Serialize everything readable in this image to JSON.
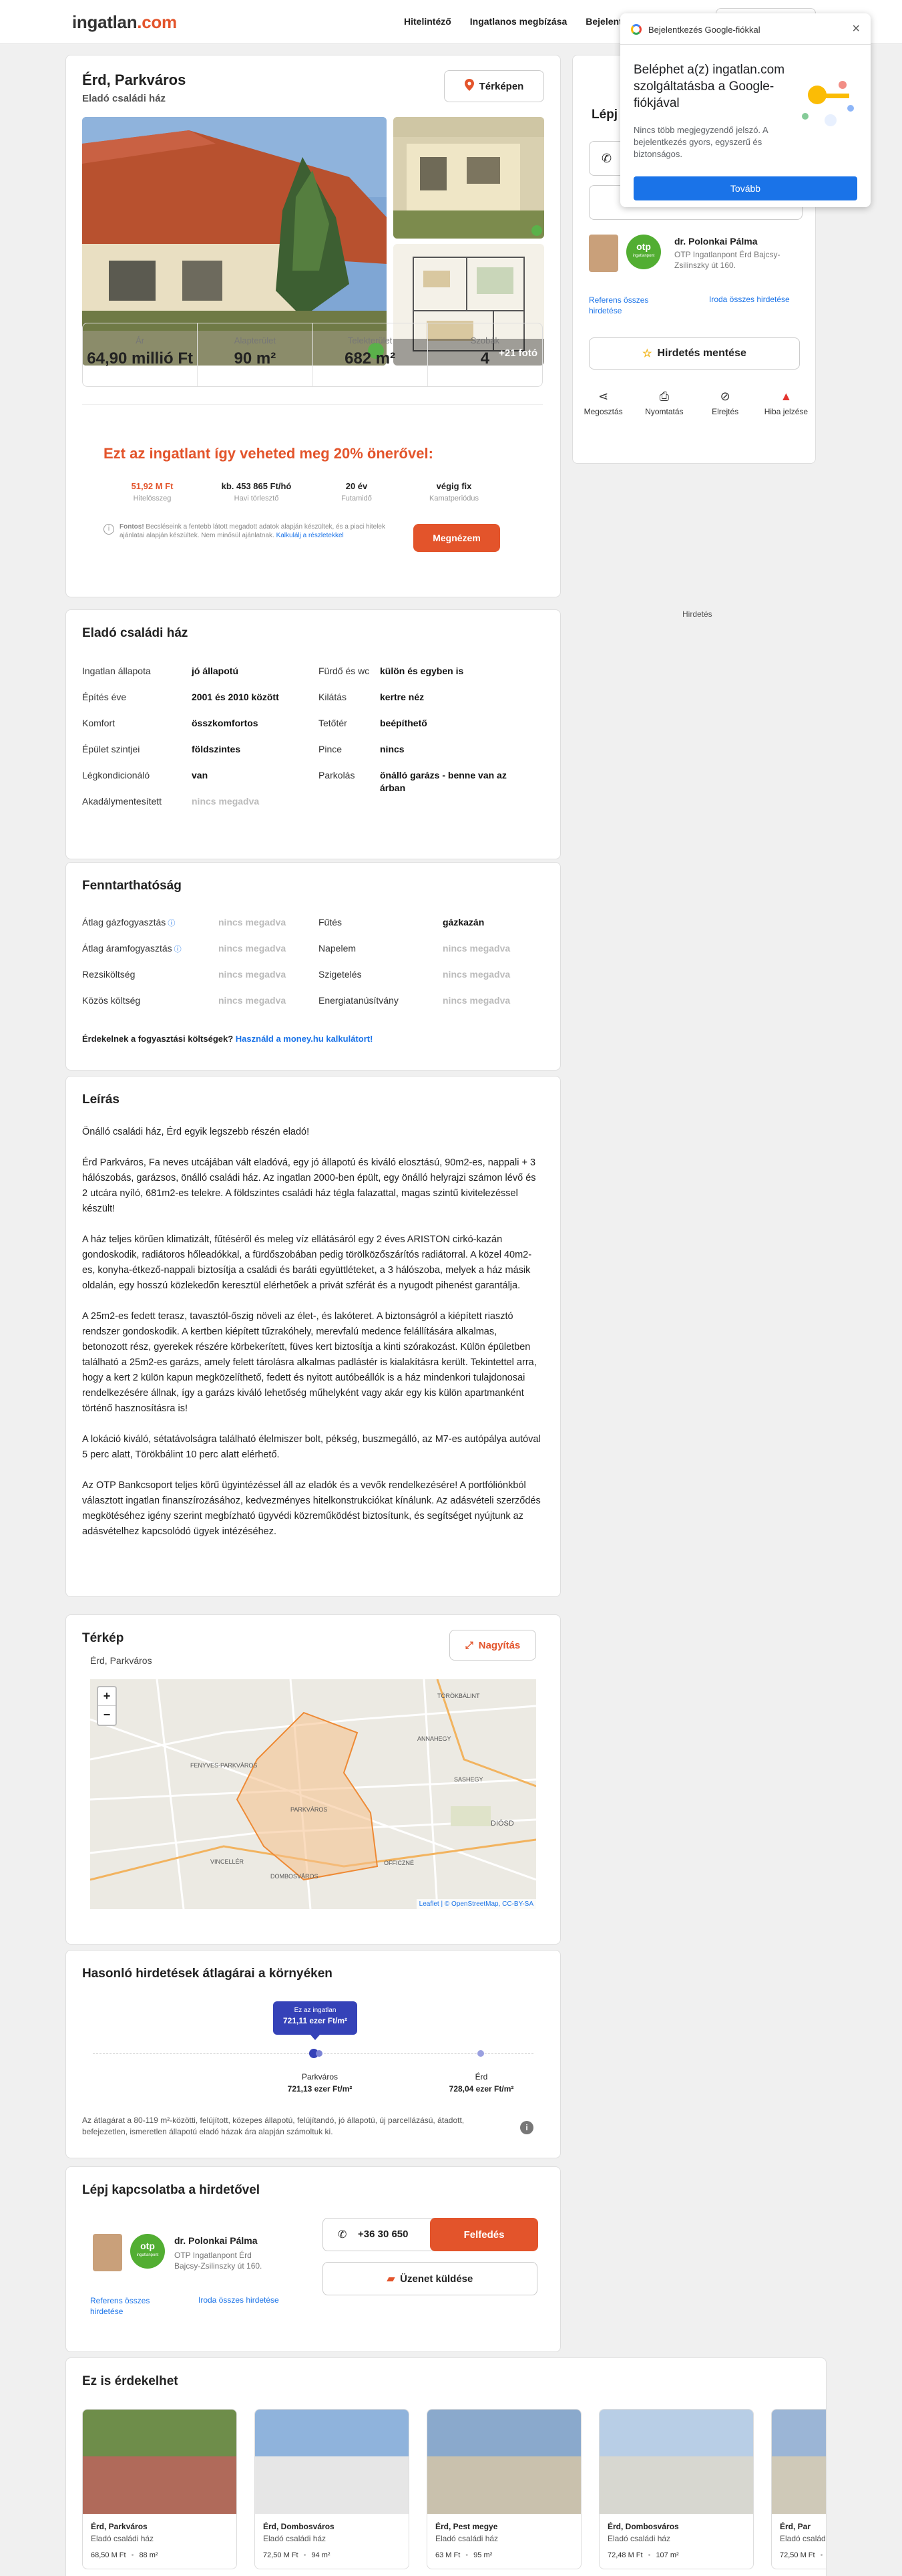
{
  "header": {
    "logo_main": "ingatlan",
    "logo_dot": ".",
    "logo_tld": "com",
    "nav": [
      "Hitelintéző",
      "Ingatlanos megbízása",
      "Bejelentk"
    ]
  },
  "listing": {
    "title": "Érd, Parkváros",
    "subtitle": "Eladó családi ház",
    "map_button": "Térképen",
    "more_photos": "+21 fotó",
    "stats": [
      {
        "label": "Ár",
        "value": "64,90 millió Ft"
      },
      {
        "label": "Alapterület",
        "value": "90 m²"
      },
      {
        "label": "Telekterület",
        "value": "682 m²"
      },
      {
        "label": "Szobák",
        "value": "4"
      }
    ]
  },
  "offer": {
    "title": "Ezt az ingatlant így veheted meg 20% önerővel:",
    "values": [
      {
        "value": "51,92 M Ft",
        "label": "Hitelösszeg"
      },
      {
        "value": "kb. 453 865 Ft/hó",
        "label": "Havi törlesztő"
      },
      {
        "value": "20 év",
        "label": "Futamidő"
      },
      {
        "value": "végig fix",
        "label": "Kamatperiódus"
      }
    ],
    "note_bold": "Fontos!",
    "note_text": " Becsléseink a fentebb látott megadott adatok alapján készültek, és a piaci hitelek ajánlatai alapján készültek. Nem minősül ajánlatnak.",
    "note_link": "Kalkulálj a részletekkel",
    "button": "Megnézem"
  },
  "agent": {
    "heading": "Lépj kapcsolatba a hirdetővel",
    "name": "dr. Polonkai Pálma",
    "office_short": "OTP Ingatlanpont Érd Bajcsy-Zsilinszky út 160.",
    "office_long": "OTP Ingatlanpont Érd Bajcsy-Zsilinszky út 160.",
    "ref_link": "Referens összes hirdetése",
    "office_link": "Iroda összes hirdetése",
    "phone": "+36 30 650",
    "call_button": "Felfedés",
    "message_button": "Üzenet küldése",
    "save_button": "Hirdetés mentése",
    "logo_text": "otp",
    "logo_sub": "ingatlanpont",
    "actions": [
      {
        "label": "Megosztás",
        "icon": "share-icon"
      },
      {
        "label": "Nyomtatás",
        "icon": "print-icon"
      },
      {
        "label": "Elrejtés",
        "icon": "hide-icon"
      },
      {
        "label": "Hiba jelzése",
        "icon": "warning-icon"
      }
    ]
  },
  "ad_label": "Hirdetés",
  "popup": {
    "title": "Bejelentkezés Google-fiókkal",
    "headline": "Beléphet a(z) ingatlan.com szolgáltatásba a Google-fiókjával",
    "body": "Nincs több megjegyzendő jelszó. A bejelentkezés gyors, egyszerű és biztonságos.",
    "button": "Tovább"
  },
  "details": {
    "title": "Eladó családi ház",
    "left": [
      {
        "k": "Ingatlan állapota",
        "v": "jó állapotú",
        "na": false
      },
      {
        "k": "Építés éve",
        "v": "2001 és 2010 között",
        "na": false
      },
      {
        "k": "Komfort",
        "v": "összkomfortos",
        "na": false
      },
      {
        "k": "Épület szintjei",
        "v": "földszintes",
        "na": false
      },
      {
        "k": "Légkondicionáló",
        "v": "van",
        "na": false
      },
      {
        "k": "Akadálymentesített",
        "v": "nincs megadva",
        "na": true
      }
    ],
    "right": [
      {
        "k": "Fürdő és wc",
        "v": "külön és egyben is",
        "na": false
      },
      {
        "k": "Kilátás",
        "v": "kertre néz",
        "na": false
      },
      {
        "k": "Tetőtér",
        "v": "beépíthető",
        "na": false
      },
      {
        "k": "Pince",
        "v": "nincs",
        "na": false
      },
      {
        "k": "Parkolás",
        "v": "önálló garázs - benne van az árban",
        "na": false
      }
    ]
  },
  "sustain": {
    "title": "Fenntarthatóság",
    "left": [
      {
        "k": "Átlag gázfogyasztás",
        "v": "nincs megadva",
        "na": true,
        "info": true
      },
      {
        "k": "Átlag áramfogyasztás",
        "v": "nincs megadva",
        "na": true,
        "info": true
      },
      {
        "k": "Rezsiköltség",
        "v": "nincs megadva",
        "na": true,
        "info": false
      },
      {
        "k": "Közös költség",
        "v": "nincs megadva",
        "na": true,
        "info": false
      }
    ],
    "right": [
      {
        "k": "Fűtés",
        "v": "gázkazán",
        "na": false
      },
      {
        "k": "Napelem",
        "v": "nincs megadva",
        "na": true
      },
      {
        "k": "Szigetelés",
        "v": "nincs megadva",
        "na": true
      },
      {
        "k": "Energiatanúsítvány",
        "v": "nincs megadva",
        "na": true
      }
    ],
    "footer_text": "Érdekelnek a fogyasztási költségek? ",
    "footer_link": "Használd a money.hu kalkulátort!"
  },
  "description": {
    "title": "Leírás",
    "paragraphs": [
      "Önálló családi ház, Érd egyik legszebb részén eladó!",
      "Érd Parkváros, Fa neves utcájában vált eladóvá, egy jó állapotú és kiváló elosztású, 90m2-es, nappali + 3 hálószobás, garázsos, önálló családi ház. Az ingatlan 2000-ben épült, egy önálló helyrajzi számon lévő és 2 utcára nyíló, 681m2-es telekre. A földszintes családi ház tégla falazattal, magas szintű kivitelezéssel készült!",
      "A ház teljes körűen klimatizált, fűtéséről és meleg víz ellátásáról egy 2 éves ARISTON cirkó-kazán gondoskodik, radiátoros hőleadókkal, a fürdőszobában pedig törölközőszárítós radiátorral. A közel 40m2-es, konyha-étkező-nappali biztosítja a családi és baráti együttléteket, a 3 hálószoba, melyek a ház másik oldalán, egy hosszú közlekedőn keresztül elérhetőek a privát szférát és a nyugodt pihenést garantálja.",
      "A 25m2-es fedett terasz, tavasztól-őszig növeli az élet-, és lakóteret. A biztonságról a kiépített riasztó rendszer gondoskodik. A kertben kiépített tűzrakóhely, merevfalú medence felállítására alkalmas, betonozott rész, gyerekek részére körbekerített, füves kert biztosítja a kinti szórakozást. Külön épületben található a 25m2-es garázs, amely felett tárolásra alkalmas padlástér is kialakításra került. Tekintettel arra, hogy a kert 2 külön kapun megközelíthető, fedett és nyitott autóbeállók is a ház mindenkori tulajdonosai rendelkezésére állnak, így a garázs kiváló lehetőség műhelyként vagy akár egy kis külön apartmanként történő hasznosításra is!",
      "A lokáció kiváló, sétatávolságra található élelmiszer bolt, pékség, buszmegálló, az M7-es autópálya autóval 5 perc alatt, Törökbálint 10 perc alatt elérhető.",
      "Az OTP Bankcsoport teljes körű ügyintézéssel áll az eladók és a vevők rendelkezésére! A portfóliónkból választott ingatlan finanszírozásához, kedvezményes hitelkonstrukciókat kínálunk. Az adásvételi szerződés megkötéséhez igény szerint megbízható ügyvédi közreműködést biztosítunk, és segítséget nyújtunk az adásvételhez kapcsolódó ügyek intézéséhez."
    ]
  },
  "map": {
    "title": "Térkép",
    "subtitle": "Érd, Parkváros",
    "enlarge": "Nagyítás",
    "zoom_in": "+",
    "zoom_out": "−",
    "attribution": "Leaflet | © OpenStreetMap, CC-BY-SA",
    "labels": [
      "PARKVÁROS",
      "DIÓSD",
      "TÖRÖKBÁLINT",
      "DOMBOSVÁROS",
      "VINCELLÉR",
      "ANNAHEGY",
      "FENYVES-PARKVÁROS",
      "SASHEGY",
      "OFFICZNÉ"
    ]
  },
  "prices": {
    "title": "Hasonló hirdetések átlagárai a környéken",
    "bubble_label": "Ez az ingatlan",
    "bubble_value": "721,11 ezer Ft/m²",
    "points": [
      {
        "name": "Parkváros",
        "value": "721,13 ezer Ft/m²"
      },
      {
        "name": "Érd",
        "value": "728,04 ezer Ft/m²"
      }
    ],
    "note": "Az átlagárat a 80-119 m²-közötti, felújított, közepes állapotú, felújítandó, jó állapotú, új parcellázású, átadott, befejezetlen, ismeretlen állapotú eladó házak ára alapján számoltuk ki."
  },
  "similar": {
    "title": "Ez is érdekelhet",
    "cards": [
      {
        "city": "Érd, Parkváros",
        "type": "Eladó családi ház",
        "price": "68,50 M Ft",
        "area": "88 m²"
      },
      {
        "city": "Érd, Dombosváros",
        "type": "Eladó családi ház",
        "price": "72,50 M Ft",
        "area": "94 m²"
      },
      {
        "city": "Érd, Pest megye",
        "type": "Eladó családi ház",
        "price": "63 M Ft",
        "area": "95 m²"
      },
      {
        "city": "Érd, Dombosváros",
        "type": "Eladó családi ház",
        "price": "72,48 M Ft",
        "area": "107 m²"
      },
      {
        "city": "Érd, Par",
        "type": "Eladó családi",
        "price": "72,50 M Ft",
        "area": ""
      }
    ]
  }
}
